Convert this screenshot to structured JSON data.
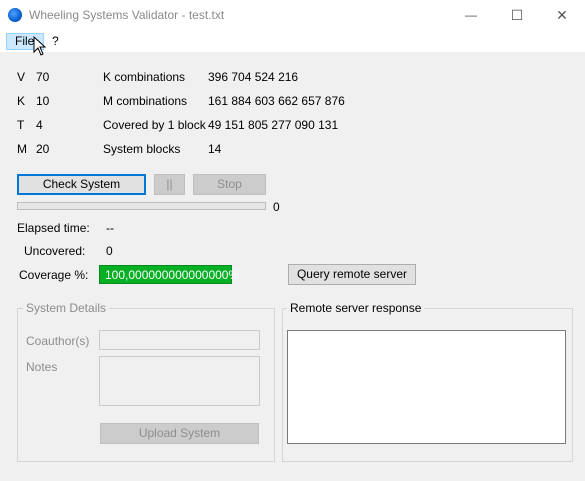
{
  "window": {
    "title": "Wheeling Systems Validator - test.txt",
    "minimize_symbol": "—",
    "maximize_symbol": "☐",
    "close_symbol": "✕"
  },
  "menu": {
    "file": "File",
    "help": "?"
  },
  "params": [
    {
      "key": "V",
      "value": "70",
      "label": "K combinations",
      "result": "396 704 524 216"
    },
    {
      "key": "K",
      "value": "10",
      "label": "M combinations",
      "result": "161 884 603 662 657 876"
    },
    {
      "key": "T",
      "value": "4",
      "label": "Covered by 1 block",
      "result": "49 151 805 277 090 131"
    },
    {
      "key": "M",
      "value": "20",
      "label": "System blocks",
      "result": "14"
    }
  ],
  "buttons": {
    "check": "Check System",
    "pause": "||",
    "stop": "Stop",
    "query": "Query remote server",
    "upload": "Upload System"
  },
  "progress": {
    "value_label": "0",
    "fraction": 0
  },
  "stats": {
    "elapsed_label": "Elapsed time:",
    "elapsed_value": "--",
    "uncovered_label": "Uncovered:",
    "uncovered_value": "0",
    "coverage_label": "Coverage %:",
    "coverage_value": "100,000000000000000%"
  },
  "details": {
    "legend": "System Details",
    "coauthors_label": "Coauthor(s)",
    "notes_label": "Notes"
  },
  "remote": {
    "legend": "Remote server response"
  },
  "colors": {
    "accent": "#0078d7",
    "coverage_bg": "#06b025"
  }
}
